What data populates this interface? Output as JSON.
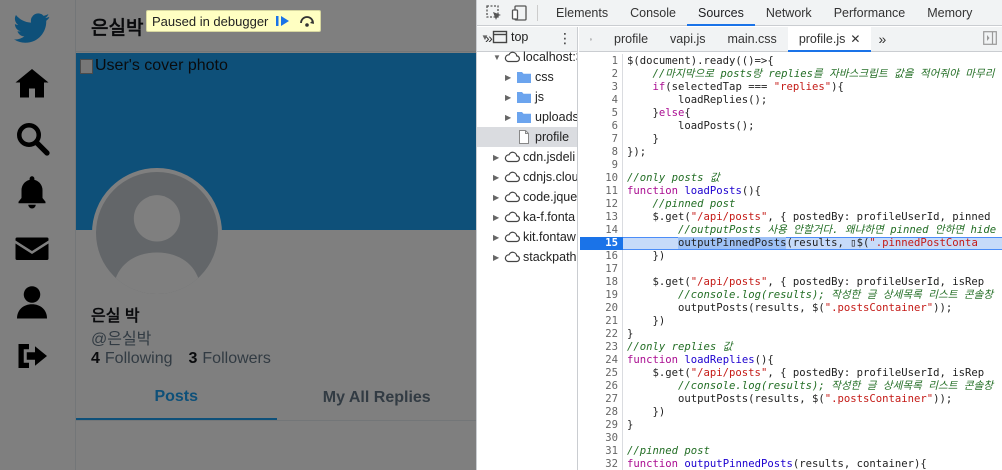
{
  "page": {
    "title": "은실박",
    "cover_alt": "User's cover photo",
    "display_name": "은실 박",
    "username": "@은실박",
    "following_count": "4",
    "following_label": "Following",
    "followers_count": "3",
    "followers_label": "Followers",
    "tabs": [
      "Posts",
      "My All Replies"
    ],
    "active_tab": "Posts",
    "brand_color": "#1da1f2"
  },
  "debugger_banner": {
    "text": "Paused in debugger"
  },
  "devtools": {
    "tabs": [
      "Elements",
      "Console",
      "Sources",
      "Network",
      "Performance",
      "Memory"
    ],
    "active_tab": "Sources",
    "nav_tree": [
      {
        "label": "top",
        "icon": "frame-icon",
        "depth": 0,
        "open": true
      },
      {
        "label": "localhost:3",
        "icon": "cloud-icon",
        "depth": 1,
        "open": true
      },
      {
        "label": "css",
        "icon": "folder-icon",
        "depth": 2,
        "open": false
      },
      {
        "label": "js",
        "icon": "folder-icon",
        "depth": 2,
        "open": false
      },
      {
        "label": "uploads",
        "icon": "folder-icon",
        "depth": 2,
        "open": false
      },
      {
        "label": "profile",
        "icon": "file-icon",
        "depth": 2,
        "selected": true
      },
      {
        "label": "cdn.jsdeli",
        "icon": "cloud-icon",
        "depth": 1,
        "open": false
      },
      {
        "label": "cdnjs.clou",
        "icon": "cloud-icon",
        "depth": 1,
        "open": false
      },
      {
        "label": "code.jque",
        "icon": "cloud-icon",
        "depth": 1,
        "open": false
      },
      {
        "label": "ka-f.fonta",
        "icon": "cloud-icon",
        "depth": 1,
        "open": false
      },
      {
        "label": "kit.fontaw",
        "icon": "cloud-icon",
        "depth": 1,
        "open": false
      },
      {
        "label": "stackpath",
        "icon": "cloud-icon",
        "depth": 1,
        "open": false
      }
    ],
    "editor_tabs": [
      "profile",
      "vapi.js",
      "main.css",
      "profile.js"
    ],
    "active_editor_tab": "profile.js",
    "paused_line": 15,
    "code_lines": [
      {
        "n": "1",
        "html": "$(document).ready(()=>{"
      },
      {
        "n": "2",
        "html": "    <span class=\"cm\">//마지막으로 posts랑 replies를 자바스크립트 값을 적어줘야 마무리</span>"
      },
      {
        "n": "3",
        "html": "    <span class=\"kw\">if</span>(selectedTap === <span class=\"str\">\"replies\"</span>){"
      },
      {
        "n": "4",
        "html": "        loadReplies();"
      },
      {
        "n": "5",
        "html": "    }<span class=\"kw\">else</span>{"
      },
      {
        "n": "6",
        "html": "        loadPosts();"
      },
      {
        "n": "7",
        "html": "    }"
      },
      {
        "n": "8",
        "html": "});"
      },
      {
        "n": "9",
        "html": ""
      },
      {
        "n": "10",
        "html": "<span class=\"cm\">//only posts 값</span>"
      },
      {
        "n": "11",
        "html": "<span class=\"kw\">function</span> <span class=\"fn\">loadPosts</span>(){"
      },
      {
        "n": "12",
        "html": "    <span class=\"cm\">//pinned post</span>"
      },
      {
        "n": "13",
        "html": "    $.get(<span class=\"str\">\"/api/posts\"</span>, { postedBy: profileUserId, pinned"
      },
      {
        "n": "14",
        "html": "        <span class=\"cm\">//outputPosts 사용 안할거다. 왜냐하면 pinned 안하면 hide</span>"
      },
      {
        "n": "15",
        "html": "        <span class=\"nav-hl\">outputPinnedPosts</span>(results, ▯$(<span class=\"str\">\".pinnedPostConta</span>"
      },
      {
        "n": "16",
        "html": "    })"
      },
      {
        "n": "17",
        "html": ""
      },
      {
        "n": "18",
        "html": "    $.get(<span class=\"str\">\"/api/posts\"</span>, { postedBy: profileUserId, isRep"
      },
      {
        "n": "19",
        "html": "        <span class=\"cm\">//console.log(results); 작성한 글 상세목록 리스트 콘솔창</span>"
      },
      {
        "n": "20",
        "html": "        outputPosts(results, $(<span class=\"str\">\".postsContainer\"</span>));"
      },
      {
        "n": "21",
        "html": "    })"
      },
      {
        "n": "22",
        "html": "}"
      },
      {
        "n": "23",
        "html": "<span class=\"cm\">//only replies 값</span>"
      },
      {
        "n": "24",
        "html": "<span class=\"kw\">function</span> <span class=\"fn\">loadReplies</span>(){"
      },
      {
        "n": "25",
        "html": "    $.get(<span class=\"str\">\"/api/posts\"</span>, { postedBy: profileUserId, isRep"
      },
      {
        "n": "26",
        "html": "        <span class=\"cm\">//console.log(results); 작성한 글 상세목록 리스트 콘솔창</span>"
      },
      {
        "n": "27",
        "html": "        outputPosts(results, $(<span class=\"str\">\".postsContainer\"</span>));"
      },
      {
        "n": "28",
        "html": "    })"
      },
      {
        "n": "29",
        "html": "}"
      },
      {
        "n": "30",
        "html": ""
      },
      {
        "n": "31",
        "html": "<span class=\"cm\">//pinned post</span>"
      },
      {
        "n": "32",
        "html": "<span class=\"kw\">function</span> <span class=\"fn\">outputPinnedPosts</span>(results, container){"
      }
    ]
  }
}
